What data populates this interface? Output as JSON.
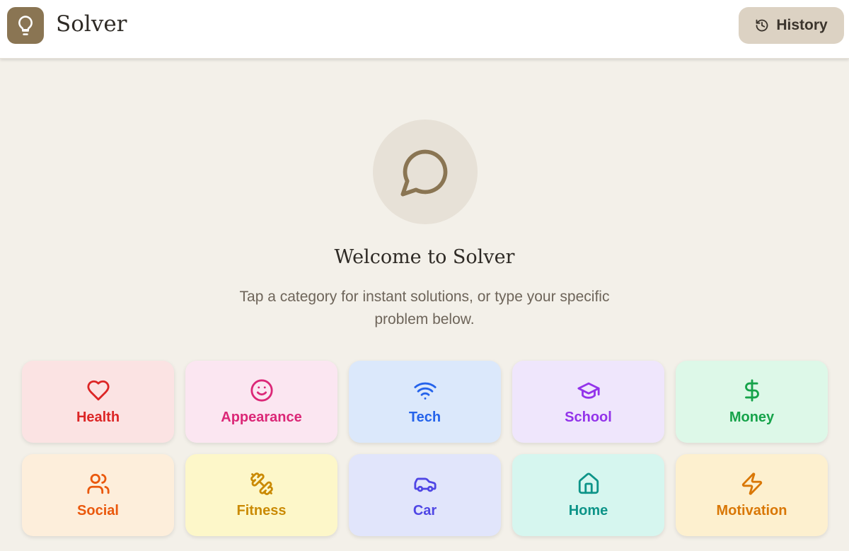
{
  "header": {
    "app_title": "Solver",
    "history_label": "History",
    "logo_icon": "lightbulb-icon"
  },
  "hero": {
    "icon": "message-circle-icon",
    "title": "Welcome to Solver",
    "subtitle": "Tap a category for instant solutions, or type your specific problem below."
  },
  "categories": [
    {
      "label": "Health",
      "icon": "heart-icon",
      "bg": "#fbe3e3",
      "color": "#dc2626"
    },
    {
      "label": "Appearance",
      "icon": "smile-icon",
      "bg": "#fbe6f1",
      "color": "#db2777"
    },
    {
      "label": "Tech",
      "icon": "wifi-icon",
      "bg": "#dbe8fb",
      "color": "#2563eb"
    },
    {
      "label": "School",
      "icon": "graduation-cap-icon",
      "bg": "#efe6fc",
      "color": "#9333ea"
    },
    {
      "label": "Money",
      "icon": "dollar-icon",
      "bg": "#ddf8e8",
      "color": "#16a34a"
    },
    {
      "label": "Social",
      "icon": "users-icon",
      "bg": "#fdeedb",
      "color": "#ea580c"
    },
    {
      "label": "Fitness",
      "icon": "dumbbell-icon",
      "bg": "#fdf7c9",
      "color": "#ca8a04"
    },
    {
      "label": "Car",
      "icon": "car-icon",
      "bg": "#e1e5fb",
      "color": "#4f46e5"
    },
    {
      "label": "Home",
      "icon": "home-icon",
      "bg": "#d6f6ef",
      "color": "#0d9488"
    },
    {
      "label": "Motivation",
      "icon": "zap-icon",
      "bg": "#fdf0cf",
      "color": "#d97706"
    }
  ]
}
